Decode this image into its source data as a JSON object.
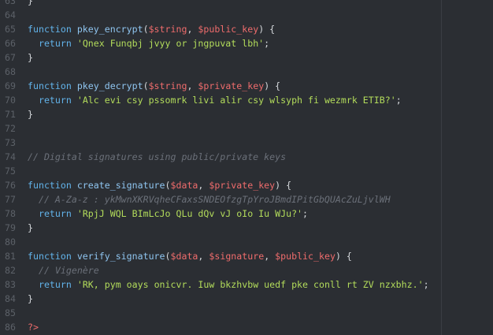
{
  "editor": {
    "lines": [
      {
        "num": "63",
        "code": [
          {
            "t": "}",
            "c": "pn"
          }
        ]
      },
      {
        "num": "64",
        "code": []
      },
      {
        "num": "65",
        "code": [
          {
            "t": "function",
            "c": "kw"
          },
          {
            "t": " ",
            "c": "pn"
          },
          {
            "t": "pkey_encrypt",
            "c": "fn"
          },
          {
            "t": "(",
            "c": "pn"
          },
          {
            "t": "$string",
            "c": "var"
          },
          {
            "t": ", ",
            "c": "pn"
          },
          {
            "t": "$public_key",
            "c": "var"
          },
          {
            "t": ") {",
            "c": "pn"
          }
        ]
      },
      {
        "num": "66",
        "code": [
          {
            "t": "  ",
            "c": "pn"
          },
          {
            "t": "return",
            "c": "kw"
          },
          {
            "t": " ",
            "c": "pn"
          },
          {
            "t": "'Qnex Funqbj jvyy or jngpuvat lbh'",
            "c": "str"
          },
          {
            "t": ";",
            "c": "pn"
          }
        ]
      },
      {
        "num": "67",
        "code": [
          {
            "t": "}",
            "c": "pn"
          }
        ]
      },
      {
        "num": "68",
        "code": []
      },
      {
        "num": "69",
        "code": [
          {
            "t": "function",
            "c": "kw"
          },
          {
            "t": " ",
            "c": "pn"
          },
          {
            "t": "pkey_decrypt",
            "c": "fn"
          },
          {
            "t": "(",
            "c": "pn"
          },
          {
            "t": "$string",
            "c": "var"
          },
          {
            "t": ", ",
            "c": "pn"
          },
          {
            "t": "$private_key",
            "c": "var"
          },
          {
            "t": ") {",
            "c": "pn"
          }
        ]
      },
      {
        "num": "70",
        "code": [
          {
            "t": "  ",
            "c": "pn"
          },
          {
            "t": "return",
            "c": "kw"
          },
          {
            "t": " ",
            "c": "pn"
          },
          {
            "t": "'Alc evi csy pssomrk livi alir csy wlsyph fi wezmrk ETIB?'",
            "c": "str"
          },
          {
            "t": ";",
            "c": "pn"
          }
        ]
      },
      {
        "num": "71",
        "code": [
          {
            "t": "}",
            "c": "pn"
          }
        ]
      },
      {
        "num": "72",
        "code": []
      },
      {
        "num": "73",
        "code": []
      },
      {
        "num": "74",
        "code": [
          {
            "t": "// Digital signatures using public/private keys",
            "c": "cm"
          }
        ]
      },
      {
        "num": "75",
        "code": []
      },
      {
        "num": "76",
        "code": [
          {
            "t": "function",
            "c": "kw"
          },
          {
            "t": " ",
            "c": "pn"
          },
          {
            "t": "create_signature",
            "c": "fn"
          },
          {
            "t": "(",
            "c": "pn"
          },
          {
            "t": "$data",
            "c": "var"
          },
          {
            "t": ", ",
            "c": "pn"
          },
          {
            "t": "$private_key",
            "c": "var"
          },
          {
            "t": ") {",
            "c": "pn"
          }
        ]
      },
      {
        "num": "77",
        "code": [
          {
            "t": "  ",
            "c": "pn"
          },
          {
            "t": "// A-Za-z : ykMwnXKRVqheCFaxsSNDEOfzgTpYroJBmdIPitGbQUAcZuLjvlWH",
            "c": "cm"
          }
        ]
      },
      {
        "num": "78",
        "code": [
          {
            "t": "  ",
            "c": "pn"
          },
          {
            "t": "return",
            "c": "kw"
          },
          {
            "t": " ",
            "c": "pn"
          },
          {
            "t": "'RpjJ WQL BImLcJo QLu dQv vJ oIo Iu WJu?'",
            "c": "str"
          },
          {
            "t": ";",
            "c": "pn"
          }
        ]
      },
      {
        "num": "79",
        "code": [
          {
            "t": "}",
            "c": "pn"
          }
        ]
      },
      {
        "num": "80",
        "code": []
      },
      {
        "num": "81",
        "code": [
          {
            "t": "function",
            "c": "kw"
          },
          {
            "t": " ",
            "c": "pn"
          },
          {
            "t": "verify_signature",
            "c": "fn"
          },
          {
            "t": "(",
            "c": "pn"
          },
          {
            "t": "$data",
            "c": "var"
          },
          {
            "t": ", ",
            "c": "pn"
          },
          {
            "t": "$signature",
            "c": "var"
          },
          {
            "t": ", ",
            "c": "pn"
          },
          {
            "t": "$public_key",
            "c": "var"
          },
          {
            "t": ") {",
            "c": "pn"
          }
        ]
      },
      {
        "num": "82",
        "code": [
          {
            "t": "  ",
            "c": "pn"
          },
          {
            "t": "// Vigenère",
            "c": "cm"
          }
        ]
      },
      {
        "num": "83",
        "code": [
          {
            "t": "  ",
            "c": "pn"
          },
          {
            "t": "return",
            "c": "kw"
          },
          {
            "t": " ",
            "c": "pn"
          },
          {
            "t": "'RK, pym oays onicvr. Iuw bkzhvbw uedf pke conll rt ZV nzxbhz.'",
            "c": "str"
          },
          {
            "t": ";",
            "c": "pn"
          }
        ]
      },
      {
        "num": "84",
        "code": [
          {
            "t": "}",
            "c": "pn"
          }
        ]
      },
      {
        "num": "85",
        "code": []
      },
      {
        "num": "86",
        "code": [
          {
            "t": "?>",
            "c": "var"
          }
        ]
      }
    ]
  },
  "colors": {
    "background": "#2b2e33",
    "keyword": "#62b3ea",
    "function": "#8fc5f0",
    "variable": "#ef6c6c",
    "string": "#b3dc5b",
    "comment": "#6b7079",
    "line_number": "#5c6168"
  }
}
